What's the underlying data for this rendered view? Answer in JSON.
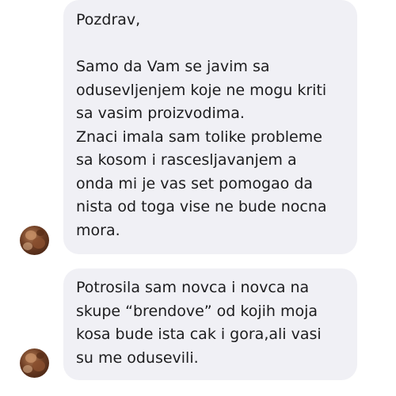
{
  "messages": [
    {
      "lines": [
        "Pozdrav,",
        "",
        "Samo da Vam se javim sa",
        "odusevljenjem koje ne mogu kriti",
        "sa vasim proizvodima.",
        "Znaci imala sam tolike probleme",
        "sa kosom i rascesljavanjem a",
        "onda mi je vas set pomogao da",
        "nista od toga vise ne bude nocna",
        "mora."
      ],
      "avatar_icon": "profile-photo"
    },
    {
      "lines": [
        "Potrosila sam novca i novca na",
        "skupe “brendove” od kojih moja",
        "kosa bude ista cak i gora,ali vasi",
        "su me odusevili."
      ],
      "avatar_icon": "profile-photo"
    }
  ],
  "colors": {
    "bubble_background": "#f0f0f5",
    "text": "#1c1c1e",
    "page_background": "#ffffff"
  }
}
